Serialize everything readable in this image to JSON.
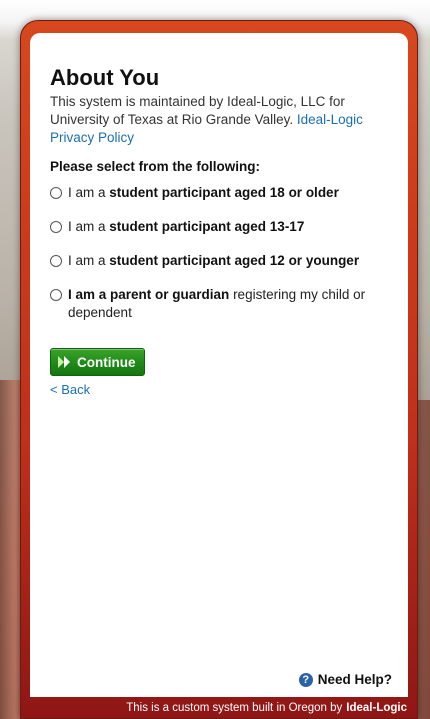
{
  "page": {
    "title": "About You",
    "intro_text": "This system is maintained by Ideal-Logic, LLC for University of Texas at Rio Grande Valley.",
    "privacy_link": "Ideal-Logic Privacy Policy",
    "prompt": "Please select from the following:"
  },
  "options": [
    {
      "prefix": "I am a",
      "bold": "student participant aged 18 or older",
      "suffix": ""
    },
    {
      "prefix": "I am a",
      "bold": "student participant aged 13-17",
      "suffix": ""
    },
    {
      "prefix": "I am a",
      "bold": "student participant aged 12 or younger",
      "suffix": ""
    },
    {
      "prefix": "",
      "bold": "I am a parent or guardian",
      "suffix": "registering my child or dependent"
    }
  ],
  "actions": {
    "continue_label": "Continue",
    "back_label": "< Back"
  },
  "help": {
    "label": "Need Help?"
  },
  "footer": {
    "text": "This is a custom system built in Oregon by",
    "brand": "Ideal-Logic"
  },
  "colors": {
    "frame_red": "#cf3f1a",
    "link_blue": "#1a6fb3",
    "continue_green": "#1f8a18",
    "help_blue": "#2b62a8"
  }
}
